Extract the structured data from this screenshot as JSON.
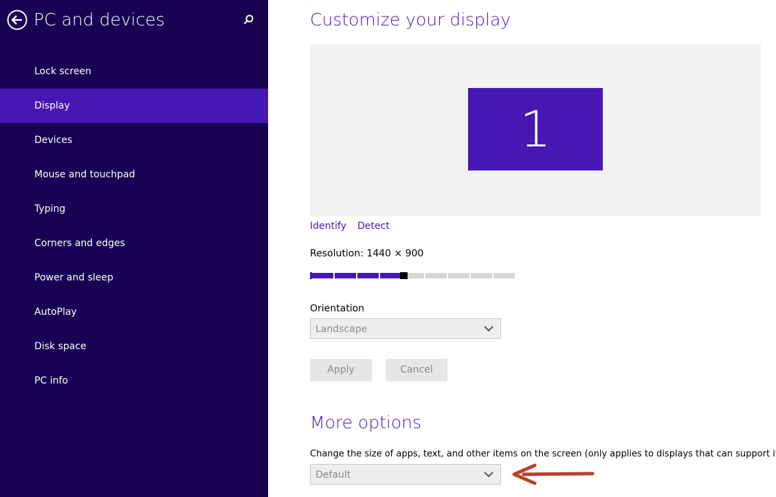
{
  "sidebar": {
    "title": "PC and devices",
    "back_icon": "back-arrow-circle-icon",
    "search_icon": "search-icon",
    "items": [
      {
        "label": "Lock screen"
      },
      {
        "label": "Display",
        "active": true
      },
      {
        "label": "Devices"
      },
      {
        "label": "Mouse and touchpad"
      },
      {
        "label": "Typing"
      },
      {
        "label": "Corners and edges"
      },
      {
        "label": "Power and sleep"
      },
      {
        "label": "AutoPlay"
      },
      {
        "label": "Disk space"
      },
      {
        "label": "PC info"
      }
    ]
  },
  "main": {
    "title": "Customize your display",
    "monitor_number": "1",
    "identify_link": "Identify",
    "detect_link": "Detect",
    "resolution_label": "Resolution: 1440 × 900",
    "resolution_slider": {
      "steps": 9,
      "selected_step": 5
    },
    "orientation": {
      "label": "Orientation",
      "value": "Landscape"
    },
    "apply_label": "Apply",
    "cancel_label": "Cancel",
    "more_options": {
      "title": "More options",
      "scaling_label": "Change the size of apps, text, and other items on the screen (only applies to displays that can support it)",
      "scaling_value": "Default"
    }
  },
  "colors": {
    "sidebar_bg": "#180052",
    "accent": "#4617b4",
    "annotation_arrow": "#b5432d"
  }
}
